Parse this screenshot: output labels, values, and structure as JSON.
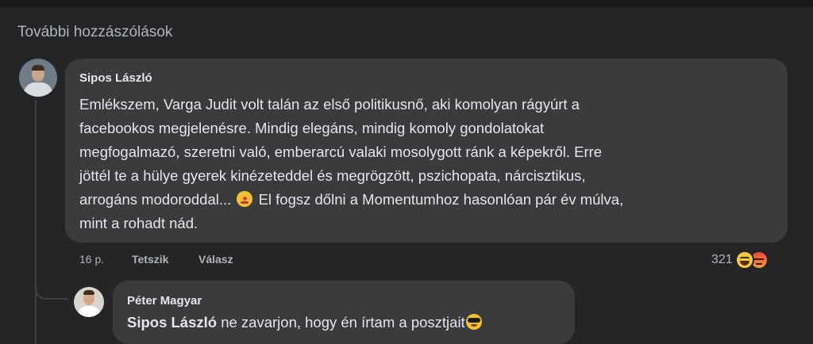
{
  "header": {
    "more_comments_label": "További hozzászólások"
  },
  "comment": {
    "author": "Sipos László",
    "text_lines": [
      "Emlékszem, Varga Judit volt talán az első politikusnő, aki komolyan rágyúrt a",
      "facebookos megjelenésre. Mindig elegáns, mindig komoly gondolatokat",
      "megfogalmazó, szeretni való, emberarcú valaki mosolygott ránk a képekről. Erre",
      "jöttél te a hülye gyerek kinézeteddel és megrögzött, pszichopata, nárcisztikus,",
      "arrogáns modoroddal...",
      "El fogsz dőlni a Momentumhoz hasonlóan pár év múlva,",
      "mint a rohadt nád."
    ],
    "emoji_icon": "clown-face-icon",
    "time": "16 p.",
    "like_label": "Tetszik",
    "reply_label": "Válasz",
    "reaction_count": "321",
    "reaction_icons": [
      "haha-reaction-icon",
      "angry-reaction-icon"
    ]
  },
  "reply": {
    "author": "Péter Magyar",
    "mention": "Sipos László",
    "text": " ne zavarjon, hogy én írtam a posztjait",
    "emoji_icon": "sunglasses-face-icon"
  },
  "colors": {
    "background": "#242526",
    "bubble": "#3a3b3c",
    "text": "#e4e6eb",
    "secondary_text": "#b0b3b8"
  }
}
